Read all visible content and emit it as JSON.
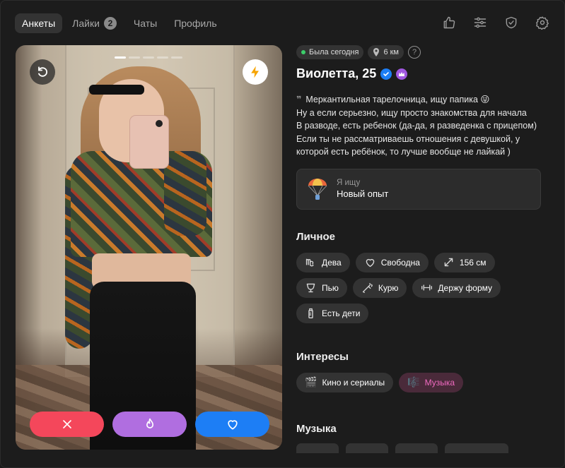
{
  "nav": {
    "tabs": [
      {
        "label": "Анкеты"
      },
      {
        "label": "Лайки",
        "count": "2"
      },
      {
        "label": "Чаты"
      },
      {
        "label": "Профиль"
      }
    ],
    "active_tab": "Анкеты",
    "right_icons": [
      "thumbs-up-icon",
      "filters-icon",
      "shield-check-icon",
      "settings-gear-icon"
    ]
  },
  "photo": {
    "total_photos": 5,
    "current_photo": 1,
    "actions": [
      "dislike",
      "superlike",
      "like"
    ]
  },
  "profile": {
    "status": "Была сегодня",
    "distance": "6 км",
    "help": "?",
    "name": "Виолетта, 25",
    "bio_quote": "❞",
    "bio": "Меркантильная тарелочница, ищу папика 😜\nНу а если серьезно, ищу просто знакомства для начала\nВ разводе, есть ребенок (да-да, я разведенка с прицепом)\nЕсли ты не рассматриваешь отношения с девушкой, у которой есть ребёнок, то лучше вообще не лайкай )",
    "looking_for_label": "Я ищу",
    "looking_for_value": "Новый опыт"
  },
  "personal": {
    "title": "Личное",
    "tags": [
      {
        "label": "Дева",
        "icon": "virgo-icon"
      },
      {
        "label": "Свободна",
        "icon": "heart-icon"
      },
      {
        "label": "156 см",
        "icon": "height-arrows-icon"
      },
      {
        "label": "Пью",
        "icon": "glass-icon"
      },
      {
        "label": "Курю",
        "icon": "cigarette-icon"
      },
      {
        "label": "Держу форму",
        "icon": "dumbbell-icon"
      },
      {
        "label": "Есть дети",
        "icon": "baby-bottle-icon"
      }
    ]
  },
  "interests": {
    "title": "Интересы",
    "tags": [
      {
        "label": "Кино и сериалы",
        "icon": "🎬"
      },
      {
        "label": "Музыка",
        "icon": "🎼",
        "highlight": "#f06ac0"
      }
    ]
  },
  "music": {
    "title": "Музыка"
  },
  "colors": {
    "dislike": "#f4475b",
    "superlike": "#b06ee0",
    "like": "#1d7ef5",
    "online": "#3ccd6a"
  }
}
